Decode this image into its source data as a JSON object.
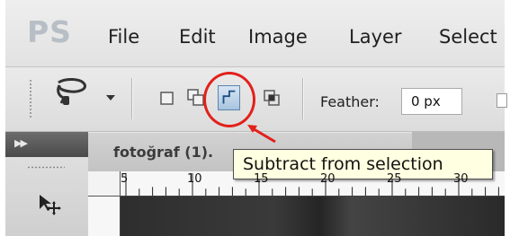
{
  "app": {
    "logo_text": "PS",
    "menu": [
      "File",
      "Edit",
      "Image",
      "Layer",
      "Select"
    ]
  },
  "options_bar": {
    "tool_icon": "lasso-tool-icon",
    "selection_modes": [
      {
        "icon": "new-selection-icon"
      },
      {
        "icon": "add-to-selection-icon"
      },
      {
        "icon": "subtract-from-selection-icon",
        "active": true
      },
      {
        "icon": "intersect-with-selection-icon"
      }
    ],
    "feather_label": "Feather:",
    "feather_value": "0 px"
  },
  "document": {
    "tab_title": "fotoğraf (1)."
  },
  "ruler": {
    "labels": [
      "5",
      "10",
      "15",
      "20",
      "25",
      "30"
    ]
  },
  "tooltip": {
    "text": "Subtract from selection"
  },
  "annotation": {
    "color": "#e3201b"
  }
}
